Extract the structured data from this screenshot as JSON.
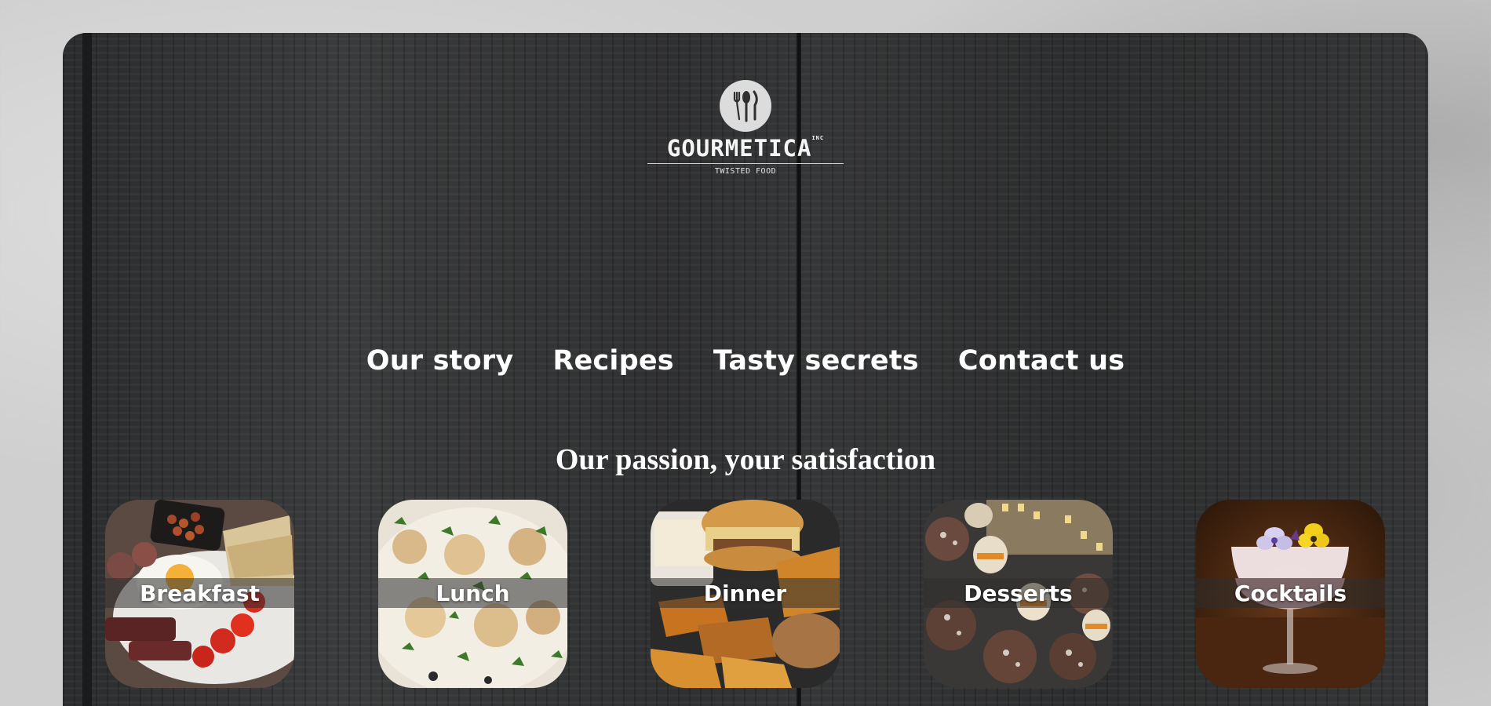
{
  "brand": {
    "name": "GOURMETICA",
    "trademark": "INC",
    "tagline": "TWISTED FOOD",
    "logo_icon": "fork-spoon-knife-icon"
  },
  "nav": {
    "items": [
      {
        "label": "Our story"
      },
      {
        "label": "Recipes"
      },
      {
        "label": "Tasty secrets"
      },
      {
        "label": "Contact us"
      }
    ]
  },
  "hero": {
    "tagline": "Our passion, your satisfaction"
  },
  "categories": [
    {
      "label": "Breakfast"
    },
    {
      "label": "Lunch"
    },
    {
      "label": "Dinner"
    },
    {
      "label": "Desserts"
    },
    {
      "label": "Cocktails"
    }
  ],
  "colors": {
    "page_background": "#cfcfcf",
    "wood_background": "#303132",
    "text": "#ffffff"
  }
}
